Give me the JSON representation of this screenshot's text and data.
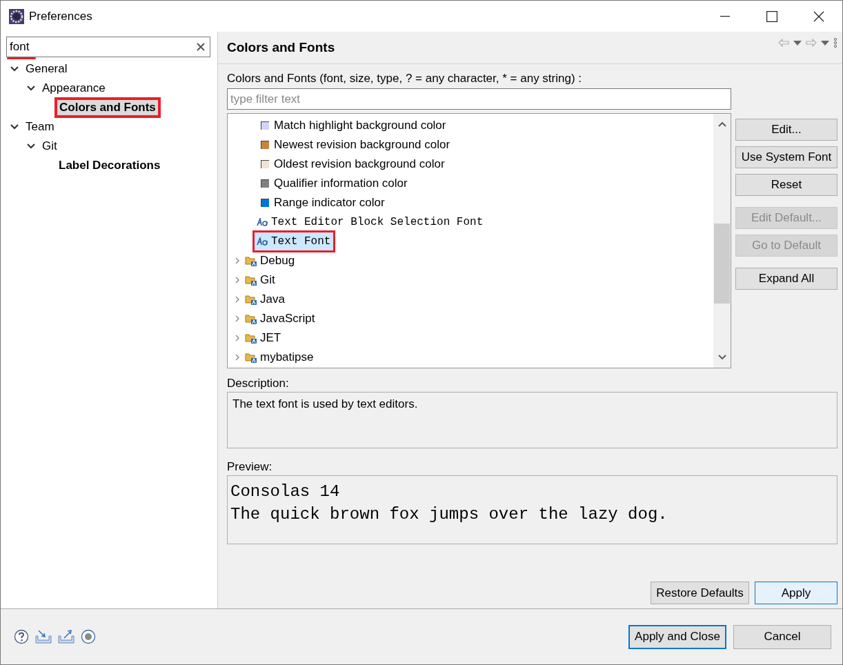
{
  "window": {
    "title": "Preferences"
  },
  "filter": {
    "value": "font",
    "annotated": true
  },
  "tree": [
    {
      "label": "General",
      "expanded": true,
      "matched": false,
      "selected": false,
      "annotated": false,
      "children": [
        {
          "label": "Appearance",
          "expanded": true,
          "matched": false,
          "selected": false,
          "annotated": false,
          "children": [
            {
              "label": "Colors and Fonts",
              "matched": true,
              "selected": true,
              "annotated": true
            }
          ]
        }
      ]
    },
    {
      "label": "Team",
      "expanded": true,
      "matched": false,
      "selected": false,
      "annotated": false,
      "children": [
        {
          "label": "Git",
          "expanded": true,
          "matched": false,
          "selected": false,
          "annotated": false,
          "children": [
            {
              "label": "Label Decorations",
              "matched": true,
              "selected": false,
              "annotated": false
            }
          ]
        }
      ]
    }
  ],
  "page": {
    "title": "Colors and Fonts",
    "filter_label": "Colors and Fonts (font, size, type, ? = any character, * = any string) :",
    "filter_placeholder": "type filter text",
    "items": [
      {
        "kind": "color",
        "label": "Match highlight background color",
        "color": "#d4d4f8",
        "selected": false,
        "annotated": false
      },
      {
        "kind": "color",
        "label": "Newest revision background color",
        "color": "#c8843a",
        "selected": false,
        "annotated": false
      },
      {
        "kind": "color",
        "label": "Oldest revision background color",
        "color": "#f2e2d2",
        "selected": false,
        "annotated": false
      },
      {
        "kind": "color",
        "label": "Qualifier information color",
        "color": "#808080",
        "selected": false,
        "annotated": false
      },
      {
        "kind": "color",
        "label": "Range indicator color",
        "color": "#0074d9",
        "selected": false,
        "annotated": false
      },
      {
        "kind": "font",
        "label": "Text Editor Block Selection Font",
        "selected": false,
        "annotated": false
      },
      {
        "kind": "font",
        "label": "Text Font",
        "selected": true,
        "annotated": true
      },
      {
        "kind": "category",
        "label": "Debug",
        "selected": false,
        "annotated": false
      },
      {
        "kind": "category",
        "label": "Git",
        "selected": false,
        "annotated": false
      },
      {
        "kind": "category",
        "label": "Java",
        "selected": false,
        "annotated": false
      },
      {
        "kind": "category",
        "label": "JavaScript",
        "selected": false,
        "annotated": false
      },
      {
        "kind": "category",
        "label": "JET",
        "selected": false,
        "annotated": false
      },
      {
        "kind": "category",
        "label": "mybatipse",
        "selected": false,
        "annotated": false
      }
    ],
    "buttons": [
      {
        "label": "Edit...",
        "disabled": false
      },
      {
        "label": "Use System Font",
        "disabled": false
      },
      {
        "label": "Reset",
        "disabled": false
      },
      {
        "label": "Edit Default...",
        "disabled": true
      },
      {
        "label": "Go to Default",
        "disabled": true
      },
      {
        "label": "Expand All",
        "disabled": false
      }
    ],
    "description_label": "Description:",
    "description": "The text font is used by text editors.",
    "preview_label": "Preview:",
    "preview_lines": [
      "Consolas 14",
      "The quick brown fox jumps over the lazy dog."
    ],
    "page_buttons": [
      {
        "label": "Restore Defaults",
        "hovered": false
      },
      {
        "label": "Apply",
        "hovered": true
      }
    ]
  },
  "footer_buttons": [
    {
      "label": "Apply and Close",
      "focused": true
    },
    {
      "label": "Cancel",
      "focused": false
    }
  ]
}
